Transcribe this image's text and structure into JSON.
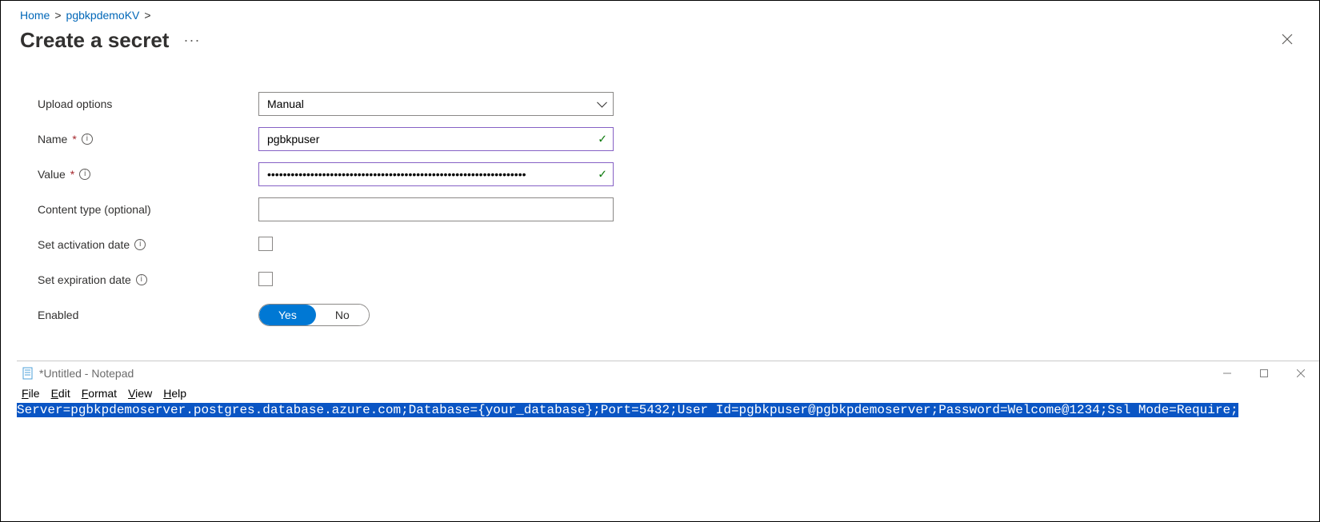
{
  "breadcrumb": {
    "home": "Home",
    "kv": "pgbkpdemoKV"
  },
  "page": {
    "title": "Create a secret",
    "more": "···"
  },
  "form": {
    "upload_label": "Upload options",
    "upload_value": "Manual",
    "name_label": "Name",
    "name_value": "pgbkpuser",
    "value_label": "Value",
    "value_masked": "••••••••••••••••••••••••••••••••••••••••••••••••••••••••••••••••••",
    "content_type_label": "Content type (optional)",
    "content_type_value": "",
    "activation_label": "Set activation date",
    "expiration_label": "Set expiration date",
    "enabled_label": "Enabled",
    "enabled_yes": "Yes",
    "enabled_no": "No"
  },
  "notepad": {
    "title": "*Untitled - Notepad",
    "menu": {
      "file": "File",
      "edit": "Edit",
      "format": "Format",
      "view": "View",
      "help": "Help"
    },
    "content": "Server=pgbkpdemoserver.postgres.database.azure.com;Database={your_database};Port=5432;User Id=pgbkpuser@pgbkpdemoserver;Password=Welcome@1234;Ssl Mode=Require;"
  }
}
